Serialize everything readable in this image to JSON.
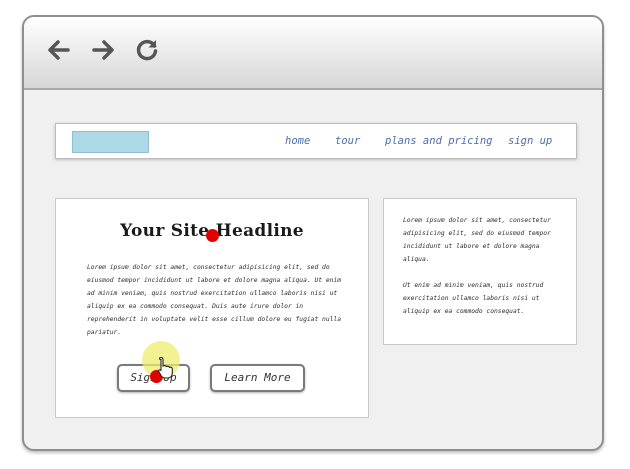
{
  "browser": {
    "back_icon": "arrow-left-icon",
    "forward_icon": "arrow-right-icon",
    "reload_icon": "reload-icon"
  },
  "nav": {
    "logo_color": "#add8e6",
    "links": [
      "home",
      "tour",
      "plans and pricing",
      "sign up"
    ]
  },
  "main": {
    "headline": "Your Site Headline",
    "body": "Lorem ipsum dolor sit amet, consectetur adipisicing elit, sed do eiusmod tempor incididunt ut labore et dolore magna aliqua. Ut enim ad minim veniam, quis nostrud exercitation ullamco laboris nisi ut aliquip ex ea commodo consequat. Duis aute irure dolor in reprehenderit in voluptate velit esse cillum dolore eu fugiat nulla pariatur.",
    "signup_label": "Sign Up",
    "learn_label": "Learn More"
  },
  "side": {
    "paragraph1": "Lorem ipsum dolor sit amet, consectetur adipisicing elit, sed do eiusmod tempor incididunt ut labore et dolore magna aliqua.",
    "paragraph2": "Ut enim ad minim veniam, quis nostrud exercitation ullamco laboris nisi ut aliquip ex ea commodo consequat."
  },
  "colors": {
    "marker": "#e00000",
    "click_highlight": "#eeee6e",
    "link": "#4a6ea8"
  }
}
